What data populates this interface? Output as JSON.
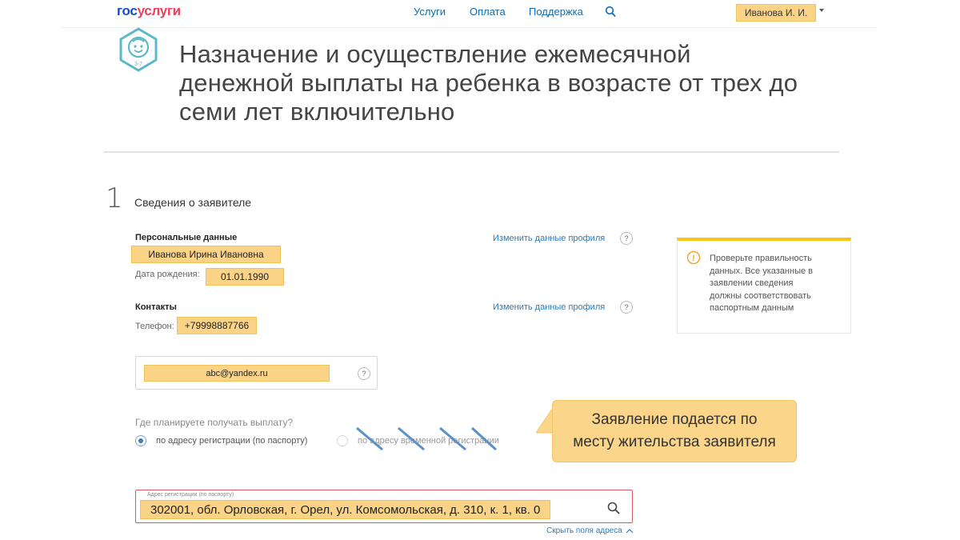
{
  "header": {
    "logo_part1": "гос",
    "logo_part2": "услуги",
    "nav": [
      "Услуги",
      "Оплата",
      "Поддержка"
    ],
    "user": "Иванова И. И."
  },
  "page": {
    "badge_age": "3-7",
    "title_line1": "Назначение и осуществление ежемесячной",
    "title_line2": "денежной выплаты на ребенка в возрасте от трех до",
    "title_line3": "семи лет включительно"
  },
  "step": {
    "number": "1",
    "title": "Сведения о заявителе"
  },
  "personal": {
    "heading": "Персональные данные",
    "full_name": "Иванова Ирина Ивановна",
    "birth_label": "Дата рождения:",
    "birth_date": "01.01.1990",
    "edit_link": "Изменить данные профиля",
    "help": "?"
  },
  "contacts": {
    "heading": "Контакты",
    "phone_label": "Телефон:",
    "phone": "+79998887766",
    "edit_link": "Изменить данные профиля",
    "help": "?",
    "email": "abc@yandex.ru",
    "email_help": "?"
  },
  "info": {
    "icon": "!",
    "text_line1": "Проверьте правильность",
    "text_line2": "данных. Все указанные в",
    "text_line3": "заявлении сведения",
    "text_line4": "должны соответствовать",
    "text_line5": "паспортным данным"
  },
  "payment": {
    "question": "Где планируете получать выплату?",
    "option1": "по адресу регистрации (по паспорту)",
    "option2": "по адресу временной регистрации",
    "selected": "option1"
  },
  "callout": {
    "line1": "Заявление подается по",
    "line2": "месту жительства заявителя"
  },
  "address": {
    "label": "Адрес регистрации (по паспорту)",
    "value": "302001, обл. Орловская, г. Орел, ул. Комсомольская, д. 310, к. 1, кв. 0",
    "hide_link": "Скрыть поля адреса"
  },
  "colors": {
    "highlight": "#fad387",
    "link": "#0d6bb5",
    "logo_blue": "#0d4cd3",
    "logo_red": "#ee3f58",
    "badge": "#5ab8c9",
    "info_accent": "#f5c518",
    "strike": "#5a8fc8",
    "error_border": "#d55a63"
  }
}
